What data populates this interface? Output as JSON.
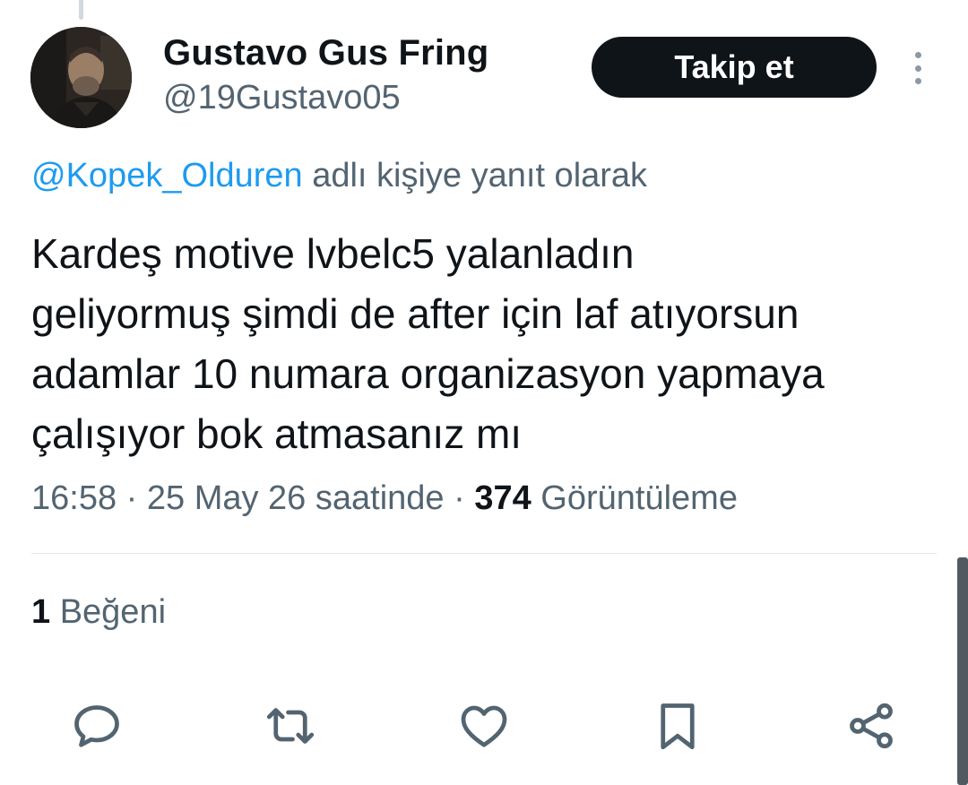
{
  "author": {
    "display_name": "Gustavo Gus Fring",
    "handle": "@19Gustavo05"
  },
  "header": {
    "follow_label": "Takip et"
  },
  "reply_context": {
    "mention": "@Kopek_Olduren",
    "suffix": " adlı kişiye yanıt olarak"
  },
  "tweet": {
    "lines": [
      "Kardeş motive lvbelc5 yalanladın",
      "geliyormuş şimdi de after için laf atıyorsun",
      "adamlar 10 numara organizasyon yapmaya",
      "çalışıyor bok atmasanız mı"
    ]
  },
  "meta": {
    "time": "16:58",
    "date": "25 May 26 saatinde",
    "separator": " · ",
    "views_count": "374",
    "views_label": " Görüntüleme"
  },
  "stats": {
    "likes_count": "1",
    "likes_label": " Beğeni"
  },
  "actions": {
    "icons": [
      "reply-icon",
      "retweet-icon",
      "like-icon",
      "bookmark-icon",
      "share-icon"
    ]
  },
  "colors": {
    "text_primary": "#0f1419",
    "text_secondary": "#536471",
    "link": "#1d9bf0",
    "button_bg": "#0f1419",
    "button_text": "#ffffff",
    "divider": "#e1e8ed"
  }
}
